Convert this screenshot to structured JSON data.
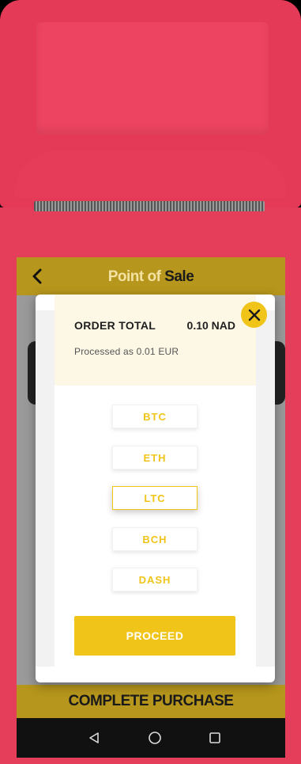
{
  "header": {
    "title_part1": "Point of",
    "title_part2": "Sale",
    "back_icon": "chevron-left-icon"
  },
  "order": {
    "label": "ORDER TOTAL",
    "amount": "0.10 NAD",
    "processed_note": "Processed as 0.01 EUR"
  },
  "currencies": [
    {
      "label": "BTC",
      "selected": false
    },
    {
      "label": "ETH",
      "selected": false
    },
    {
      "label": "LTC",
      "selected": true
    },
    {
      "label": "BCH",
      "selected": false
    },
    {
      "label": "DASH",
      "selected": false
    }
  ],
  "proceed_label": "PROCEED",
  "close_icon": "close-icon",
  "complete_label": "COMPLETE PURCHASE",
  "nav": {
    "back_icon": "triangle-back-icon",
    "home_icon": "circle-home-icon",
    "recents_icon": "square-recents-icon"
  },
  "colors": {
    "device": "#e53e5a",
    "header": "#b6961c",
    "accent": "#f0c419",
    "modal_panel": "#fdf8e6"
  }
}
